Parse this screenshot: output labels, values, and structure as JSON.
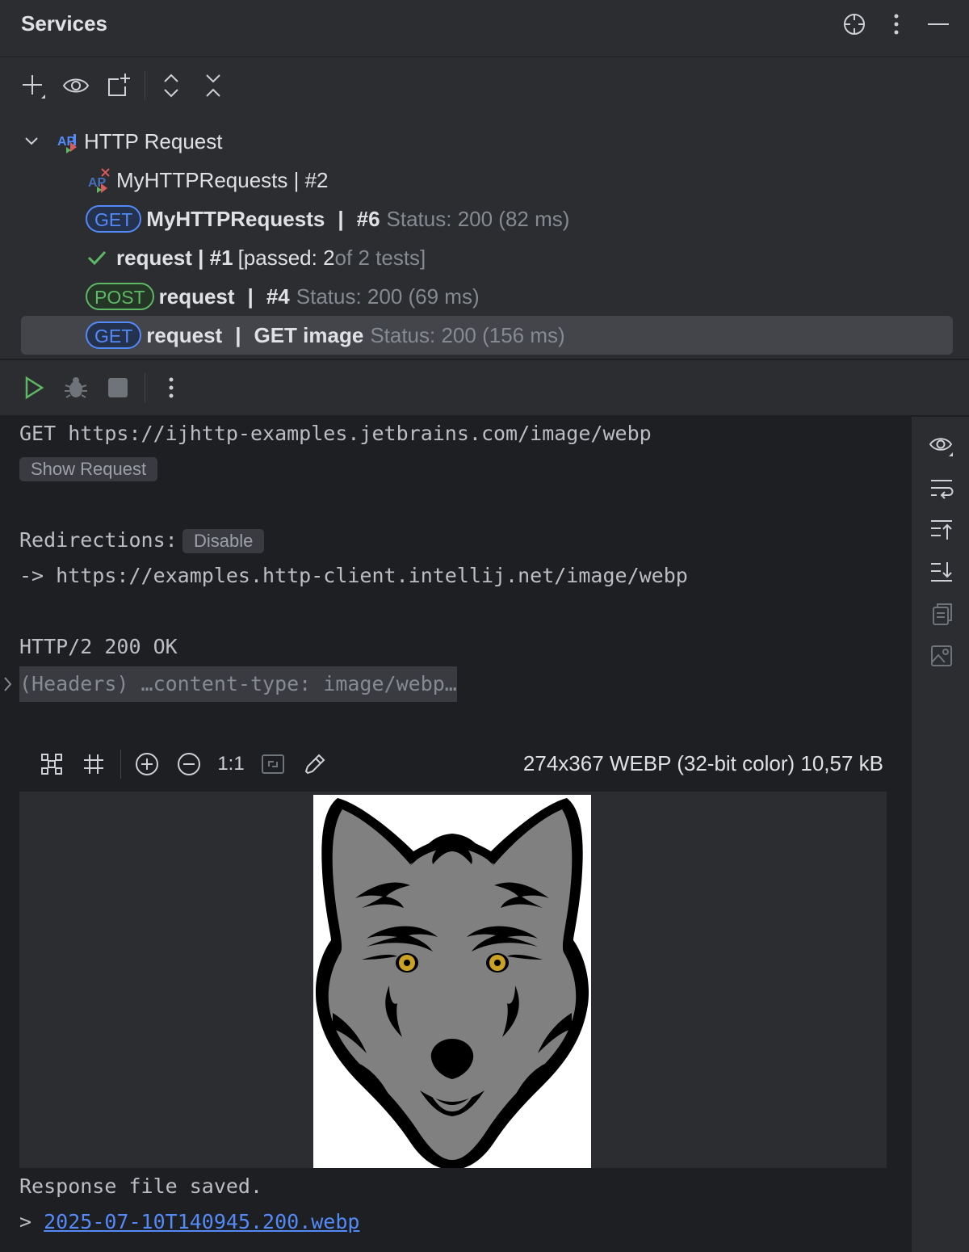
{
  "header": {
    "title": "Services"
  },
  "icons": {
    "locate": "crosshair-icon",
    "more": "more-vertical-icon",
    "minimize": "minimize-icon",
    "add": "add-icon",
    "view": "eye-icon",
    "new_group": "new-group-icon",
    "expand_all": "expand-all-icon",
    "collapse_all": "collapse-all-icon",
    "run": "run-icon",
    "debug": "debug-icon",
    "stop": "stop-icon"
  },
  "tree": {
    "root": {
      "label": "HTTP Request"
    },
    "items": [
      {
        "name": "MyHTTPRequests | #2"
      },
      {
        "method": "GET",
        "name": "MyHTTPRequests",
        "sep": "|",
        "run": "#6",
        "status": "Status: 200 (82 ms)"
      },
      {
        "name": "request | #1",
        "tests_open": "[passed: 2",
        "tests_rest": " of 2 tests]"
      },
      {
        "method": "POST",
        "name": "request",
        "sep": "|",
        "run": "#4",
        "status": "Status: 200 (69 ms)"
      },
      {
        "method": "GET",
        "name": "request",
        "sep": "|",
        "run": "GET image",
        "status": "Status: 200 (156 ms)"
      }
    ]
  },
  "console": {
    "request_line": "GET https://ijhttp-examples.jetbrains.com/image/webp",
    "show_request": "Show Request",
    "redirections_label": "Redirections:",
    "disable_label": "Disable",
    "redirect_line": "-> https://examples.http-client.intellij.net/image/webp",
    "status_line": "HTTP/2 200 OK",
    "headers_line": "(Headers) …content-type: image/webp…",
    "image_info": "274x367 WEBP (32-bit color) 10,57 kB",
    "zoom_actual": "1:1",
    "saved_line": "Response file saved.",
    "link_prefix": ">",
    "saved_file": "2025-07-10T140945.200.webp"
  },
  "colors": {
    "get": "#548af7",
    "post": "#5fb865",
    "check": "#5fb865",
    "link": "#548af7",
    "wolf_eye": "#c9a227"
  }
}
